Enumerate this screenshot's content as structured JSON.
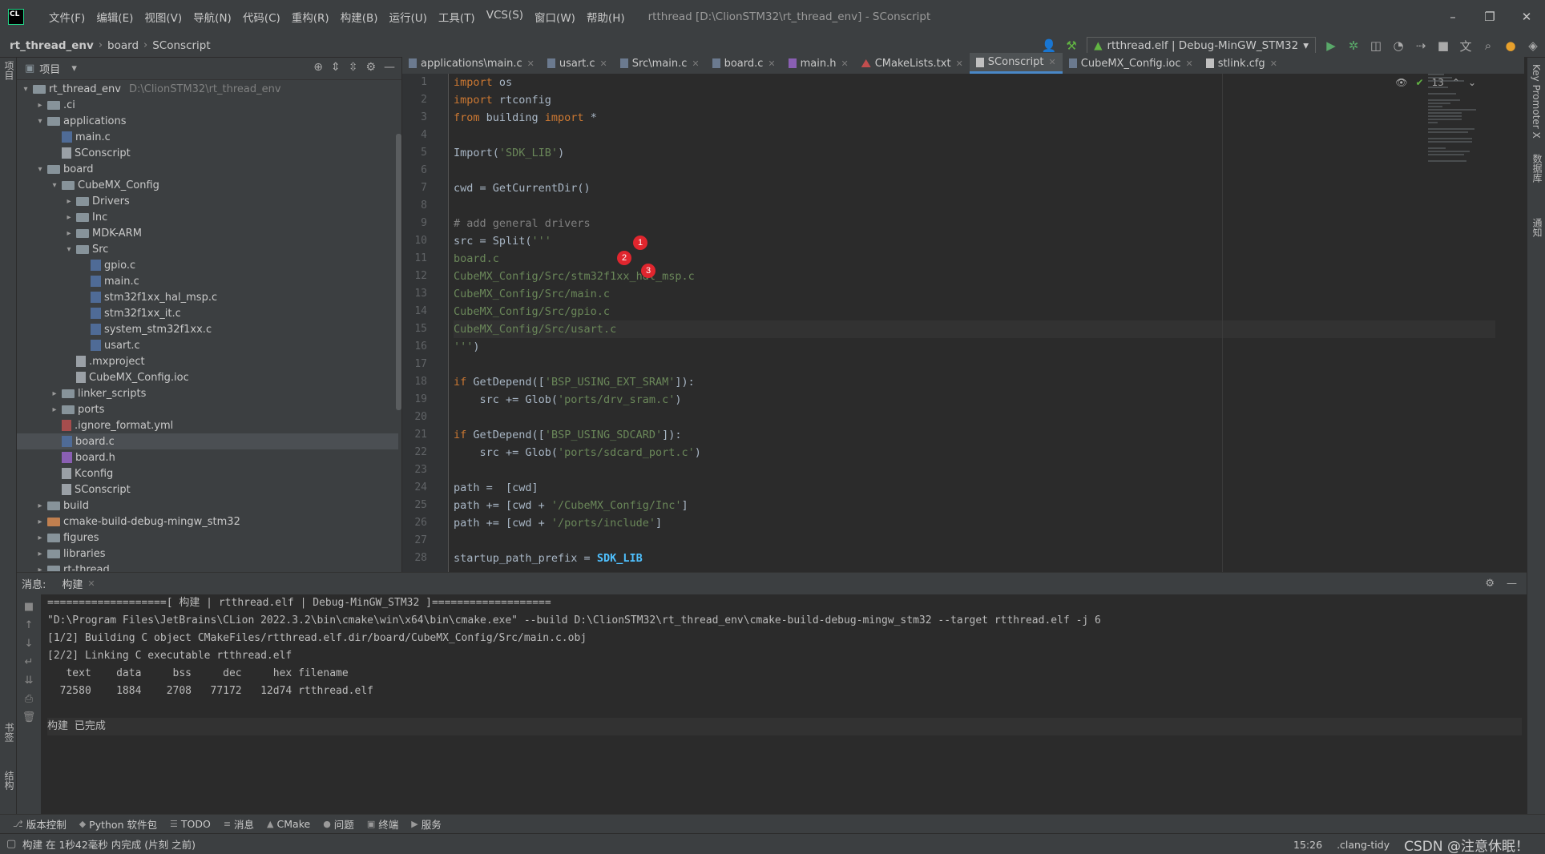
{
  "app": {
    "logo": "CL",
    "menu": [
      "文件(F)",
      "编辑(E)",
      "视图(V)",
      "导航(N)",
      "代码(C)",
      "重构(R)",
      "构建(B)",
      "运行(U)",
      "工具(T)",
      "VCS(S)",
      "窗口(W)",
      "帮助(H)"
    ],
    "title": "rtthread [D:\\ClionSTM32\\rt_thread_env] - SConscript",
    "window_controls": [
      "–",
      "❐",
      "✕"
    ]
  },
  "navbar": {
    "crumbs": [
      "rt_thread_env",
      "board",
      "SConscript"
    ],
    "run_config": "rtthread.elf | Debug-MinGW_STM32"
  },
  "stripes": {
    "left_top": "项目",
    "left_bottom_1": "书签",
    "left_bottom_2": "结构",
    "right_1": "Key Promoter X",
    "right_2": "数据库",
    "right_3": "通知"
  },
  "project": {
    "label": "项目",
    "tree": [
      {
        "depth": 0,
        "arrow": "▾",
        "icon": "folder",
        "label": "rt_thread_env",
        "hint": "D:\\ClionSTM32\\rt_thread_env"
      },
      {
        "depth": 1,
        "arrow": "▸",
        "icon": "folder",
        "label": ".ci"
      },
      {
        "depth": 1,
        "arrow": "▾",
        "icon": "folder",
        "label": "applications"
      },
      {
        "depth": 2,
        "arrow": "",
        "icon": "cfile",
        "label": "main.c"
      },
      {
        "depth": 2,
        "arrow": "",
        "icon": "txt",
        "label": "SConscript"
      },
      {
        "depth": 1,
        "arrow": "▾",
        "icon": "folder",
        "label": "board"
      },
      {
        "depth": 2,
        "arrow": "▾",
        "icon": "folder",
        "label": "CubeMX_Config"
      },
      {
        "depth": 3,
        "arrow": "▸",
        "icon": "folder",
        "label": "Drivers"
      },
      {
        "depth": 3,
        "arrow": "▸",
        "icon": "folder",
        "label": "Inc"
      },
      {
        "depth": 3,
        "arrow": "▸",
        "icon": "folder",
        "label": "MDK-ARM"
      },
      {
        "depth": 3,
        "arrow": "▾",
        "icon": "folder",
        "label": "Src"
      },
      {
        "depth": 4,
        "arrow": "",
        "icon": "cfile",
        "label": "gpio.c"
      },
      {
        "depth": 4,
        "arrow": "",
        "icon": "cfile",
        "label": "main.c"
      },
      {
        "depth": 4,
        "arrow": "",
        "icon": "cfile",
        "label": "stm32f1xx_hal_msp.c"
      },
      {
        "depth": 4,
        "arrow": "",
        "icon": "cfile",
        "label": "stm32f1xx_it.c"
      },
      {
        "depth": 4,
        "arrow": "",
        "icon": "cfile",
        "label": "system_stm32f1xx.c"
      },
      {
        "depth": 4,
        "arrow": "",
        "icon": "cfile",
        "label": "usart.c"
      },
      {
        "depth": 3,
        "arrow": "",
        "icon": "txt",
        "label": ".mxproject"
      },
      {
        "depth": 3,
        "arrow": "",
        "icon": "txt",
        "label": "CubeMX_Config.ioc"
      },
      {
        "depth": 2,
        "arrow": "▸",
        "icon": "folder",
        "label": "linker_scripts"
      },
      {
        "depth": 2,
        "arrow": "▸",
        "icon": "folder",
        "label": "ports"
      },
      {
        "depth": 2,
        "arrow": "",
        "icon": "yml",
        "label": ".ignore_format.yml"
      },
      {
        "depth": 2,
        "arrow": "",
        "icon": "cfile",
        "label": "board.c",
        "selected": true
      },
      {
        "depth": 2,
        "arrow": "",
        "icon": "hfile",
        "label": "board.h"
      },
      {
        "depth": 2,
        "arrow": "",
        "icon": "txt",
        "label": "Kconfig"
      },
      {
        "depth": 2,
        "arrow": "",
        "icon": "txt",
        "label": "SConscript"
      },
      {
        "depth": 1,
        "arrow": "▸",
        "icon": "folder",
        "label": "build"
      },
      {
        "depth": 1,
        "arrow": "▸",
        "icon": "folder-orange",
        "label": "cmake-build-debug-mingw_stm32"
      },
      {
        "depth": 1,
        "arrow": "▸",
        "icon": "folder",
        "label": "figures"
      },
      {
        "depth": 1,
        "arrow": "▸",
        "icon": "folder",
        "label": "libraries"
      },
      {
        "depth": 1,
        "arrow": "▸",
        "icon": "folder",
        "label": "rt-thread"
      }
    ]
  },
  "tabs": [
    {
      "label": "applications\\main.c",
      "icon": "c"
    },
    {
      "label": "usart.c",
      "icon": "c"
    },
    {
      "label": "Src\\main.c",
      "icon": "c"
    },
    {
      "label": "board.c",
      "icon": "c"
    },
    {
      "label": "main.h",
      "icon": "h"
    },
    {
      "label": "CMakeLists.txt",
      "icon": "k"
    },
    {
      "label": "SConscript",
      "icon": "cm",
      "active": true
    },
    {
      "label": "CubeMX_Config.ioc",
      "icon": "c"
    },
    {
      "label": "stlink.cfg",
      "icon": "cm"
    }
  ],
  "editor": {
    "inspections": "13",
    "lines": [
      [
        [
          "kw",
          "import"
        ],
        [
          "t",
          " os"
        ]
      ],
      [
        [
          "kw",
          "import"
        ],
        [
          "t",
          " rtconfig"
        ]
      ],
      [
        [
          "kw",
          "from"
        ],
        [
          "t",
          " building "
        ],
        [
          "kw",
          "import"
        ],
        [
          "t",
          " *"
        ]
      ],
      [],
      [
        [
          "t",
          "Import("
        ],
        [
          "str",
          "'SDK_LIB'"
        ],
        [
          "t",
          ")"
        ]
      ],
      [],
      [
        [
          "t",
          "cwd = GetCurrentDir()"
        ]
      ],
      [],
      [
        [
          "cmt",
          "# add general drivers"
        ]
      ],
      [
        [
          "t",
          "src = Split("
        ],
        [
          "str",
          "'''"
        ]
      ],
      [
        [
          "str",
          "board.c"
        ]
      ],
      [
        [
          "str",
          "CubeMX_Config/Src/stm32f1xx_hal_msp.c"
        ]
      ],
      [
        [
          "str",
          "CubeMX_Config/Src/main.c"
        ]
      ],
      [
        [
          "str",
          "CubeMX_Config/Src/gpio.c"
        ]
      ],
      [
        [
          "str",
          "CubeMX_Config/Src/usart.c"
        ]
      ],
      [
        [
          "str",
          "'''"
        ],
        [
          "t",
          ")"
        ]
      ],
      [],
      [
        [
          "kw",
          "if"
        ],
        [
          "t",
          " GetDepend(["
        ],
        [
          "str",
          "'BSP_USING_EXT_SRAM'"
        ],
        [
          "t",
          "]):"
        ]
      ],
      [
        [
          "t",
          "    src += Glob("
        ],
        [
          "str",
          "'ports/drv_sram.c'"
        ],
        [
          "t",
          ")"
        ]
      ],
      [],
      [
        [
          "kw",
          "if"
        ],
        [
          "t",
          " GetDepend(["
        ],
        [
          "str",
          "'BSP_USING_SDCARD'"
        ],
        [
          "t",
          "]):"
        ]
      ],
      [
        [
          "t",
          "    src += Glob("
        ],
        [
          "str",
          "'ports/sdcard_port.c'"
        ],
        [
          "t",
          ")"
        ]
      ],
      [],
      [
        [
          "t",
          "path =  [cwd]"
        ]
      ],
      [
        [
          "t",
          "path += [cwd + "
        ],
        [
          "str",
          "'/CubeMX_Config/Inc'"
        ],
        [
          "t",
          "]"
        ]
      ],
      [
        [
          "t",
          "path += [cwd + "
        ],
        [
          "str",
          "'/ports/include'"
        ],
        [
          "t",
          "]"
        ]
      ],
      [],
      [
        [
          "t",
          "startup_path_prefix = "
        ],
        [
          "hl",
          "SDK_LIB"
        ]
      ]
    ],
    "current_line": 15,
    "badges": [
      "1",
      "2",
      "3"
    ]
  },
  "messages": {
    "label": "消息:",
    "tab": "构建",
    "output": [
      "===================[ 构建 | rtthread.elf | Debug-MinGW_STM32 ]===================",
      "\"D:\\Program Files\\JetBrains\\CLion 2022.3.2\\bin\\cmake\\win\\x64\\bin\\cmake.exe\" --build D:\\ClionSTM32\\rt_thread_env\\cmake-build-debug-mingw_stm32 --target rtthread.elf -j 6",
      "[1/2] Building C object CMakeFiles/rtthread.elf.dir/board/CubeMX_Config/Src/main.c.obj",
      "[2/2] Linking C executable rtthread.elf",
      "   text    data     bss     dec     hex filename",
      "  72580    1884    2708   77172   12d74 rtthread.elf",
      "",
      "构建 已完成"
    ]
  },
  "toolstrip": [
    {
      "icon": "⎇",
      "label": "版本控制"
    },
    {
      "icon": "◆",
      "label": "Python 软件包"
    },
    {
      "icon": "☰",
      "label": "TODO"
    },
    {
      "icon": "≡",
      "label": "消息"
    },
    {
      "icon": "▲",
      "label": "CMake"
    },
    {
      "icon": "●",
      "label": "问题"
    },
    {
      "icon": "▣",
      "label": "终端"
    },
    {
      "icon": "▶",
      "label": "服务"
    }
  ],
  "status": {
    "message": "构建 在 1秒42毫秒 内完成 (片刻 之前)",
    "position": "15:26",
    "linter": ".clang-tidy",
    "watermark": "CSDN @注意休眠！"
  }
}
